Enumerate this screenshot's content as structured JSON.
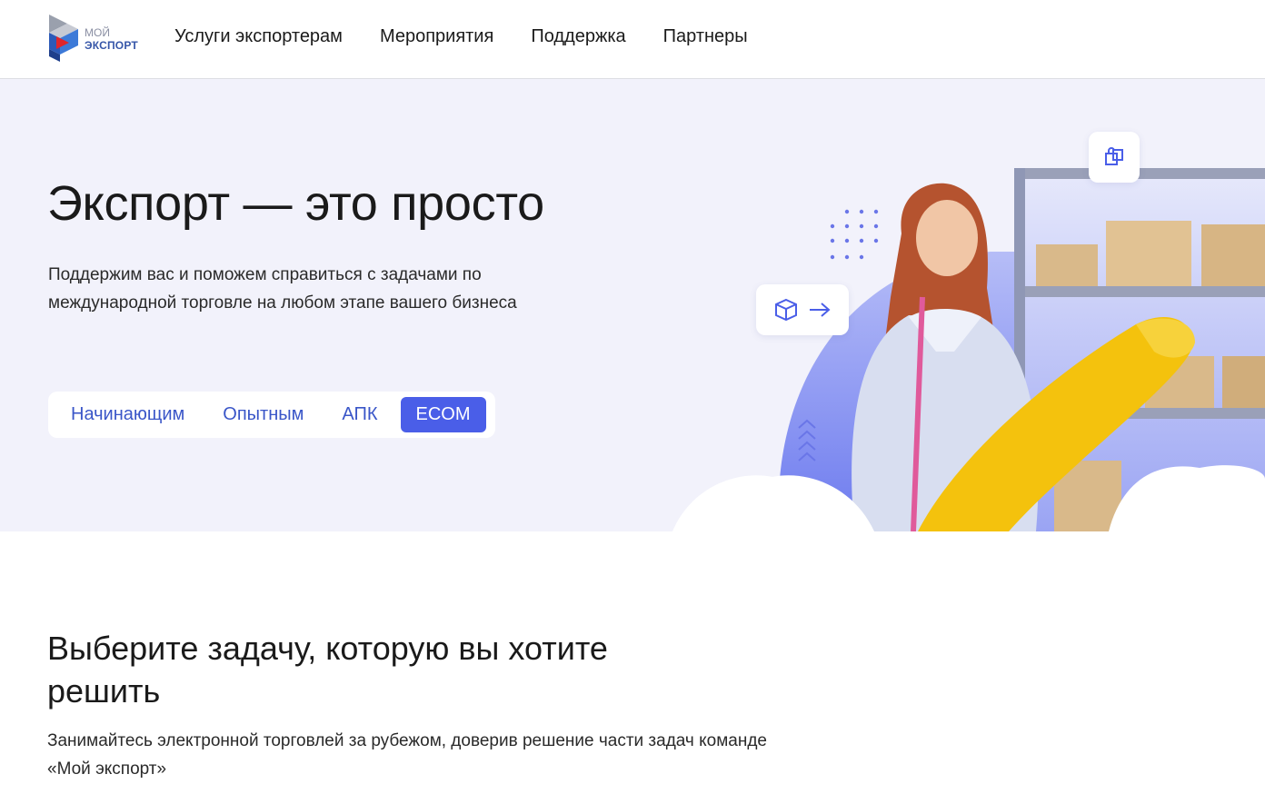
{
  "logo": {
    "line1": "МОЙ",
    "line2": "ЭКСПОРТ"
  },
  "nav": [
    {
      "label": "Услуги экспортерам"
    },
    {
      "label": "Мероприятия"
    },
    {
      "label": "Поддержка"
    },
    {
      "label": "Партнеры"
    }
  ],
  "hero": {
    "title": "Экспорт — это просто",
    "subtitle": "Поддержим вас и поможем справиться с задачами по международной торговле на любом этапе вашего бизнеса",
    "tabs": [
      {
        "label": "Начинающим",
        "active": false
      },
      {
        "label": "Опытным",
        "active": false
      },
      {
        "label": "АПК",
        "active": false
      },
      {
        "label": "ECOM",
        "active": true
      }
    ]
  },
  "section": {
    "title": "Выберите задачу, которую вы хотите решить",
    "subtitle": "Занимайтесь электронной торговлей за рубежом, доверив решение части задач команде «Мой экспорт»"
  },
  "colors": {
    "accent": "#4a5ee8",
    "hero_bg": "#f2f2fb",
    "link": "#3a56c8"
  },
  "icons": [
    "logo-mark-icon",
    "shopping-bags-icon",
    "box-icon",
    "arrow-right-icon",
    "chevrons-up-icon"
  ]
}
